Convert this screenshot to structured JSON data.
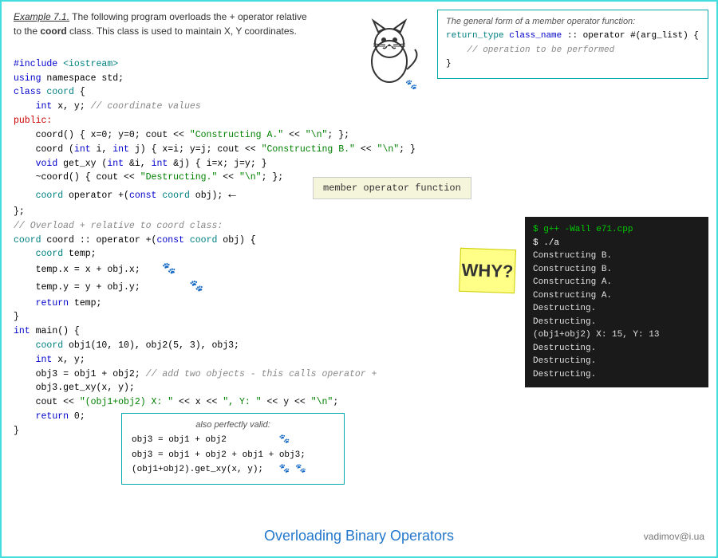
{
  "description": {
    "example_label": "Example 7.1.",
    "text": " The following program overloads the + operator relative to the ",
    "bold1": "coord",
    "text2": " class. This class is used to maintain X, Y coordinates."
  },
  "general_form": {
    "title": "The general form of a member operator function:",
    "line1": "return_type class_name :: operator #(arg_list) {",
    "line2": "        // operation to be performed",
    "line3": "    }"
  },
  "code": {
    "lines": [
      "#include <iostream>",
      "using namespace std;",
      "class coord {",
      "    int x, y; // coordinate values",
      "public:",
      "    coord() { x=0; y=0; cout << \"Constructing A.\" << \"\\n\"; };",
      "    coord (int i, int j) { x=i; y=j; cout << \"Constructing B.\" << \"\\n\"; }",
      "    void get_xy (int &i, int &j) { i=x; j=y; }",
      "    ~coord() { cout << \"Destructing.\" << \"\\n\"; };",
      "    coord operator +(const coord obj);",
      "};",
      "// Overload + relative to coord class:",
      "coord coord :: operator +(const coord obj) {",
      "    coord temp;",
      "    temp.x = x + obj.x;",
      "    temp.y = y + obj.y;",
      "    return temp;",
      "}",
      "int main() {",
      "    coord obj1(10, 10), obj2(5, 3), obj3;",
      "    int x, y;",
      "    obj3 = obj1 + obj2; // add two objects - this calls operator +",
      "    obj3.get_xy(x, y);",
      "    cout << \"(obj1+obj2) X: \" << x << \", Y: \" << y << \"\\n\";",
      "    return 0;",
      "}"
    ]
  },
  "callout": {
    "label": "member operator function"
  },
  "terminal": {
    "title": "$ g++ -Wall e71.cpp",
    "lines": [
      "$ ./a",
      "Constructing B.",
      "Constructing B.",
      "Constructing A.",
      "Constructing A.",
      "Destructing.",
      "Destructing.",
      "(obj1+obj2) X: 15, Y: 13",
      "Destructing.",
      "Destructing.",
      "Destructing."
    ]
  },
  "sticky_note": {
    "text": "WHY?"
  },
  "also_valid": {
    "title": "also perfectly valid:",
    "lines": [
      "obj3 = obj1 + obj2",
      "obj3 = obj1 + obj2 + obj1 + obj3;",
      "(obj1+obj2).get_xy(x, y);"
    ]
  },
  "footer": {
    "title": "Overloading Binary Operators",
    "email": "vadimov@i.ua"
  }
}
